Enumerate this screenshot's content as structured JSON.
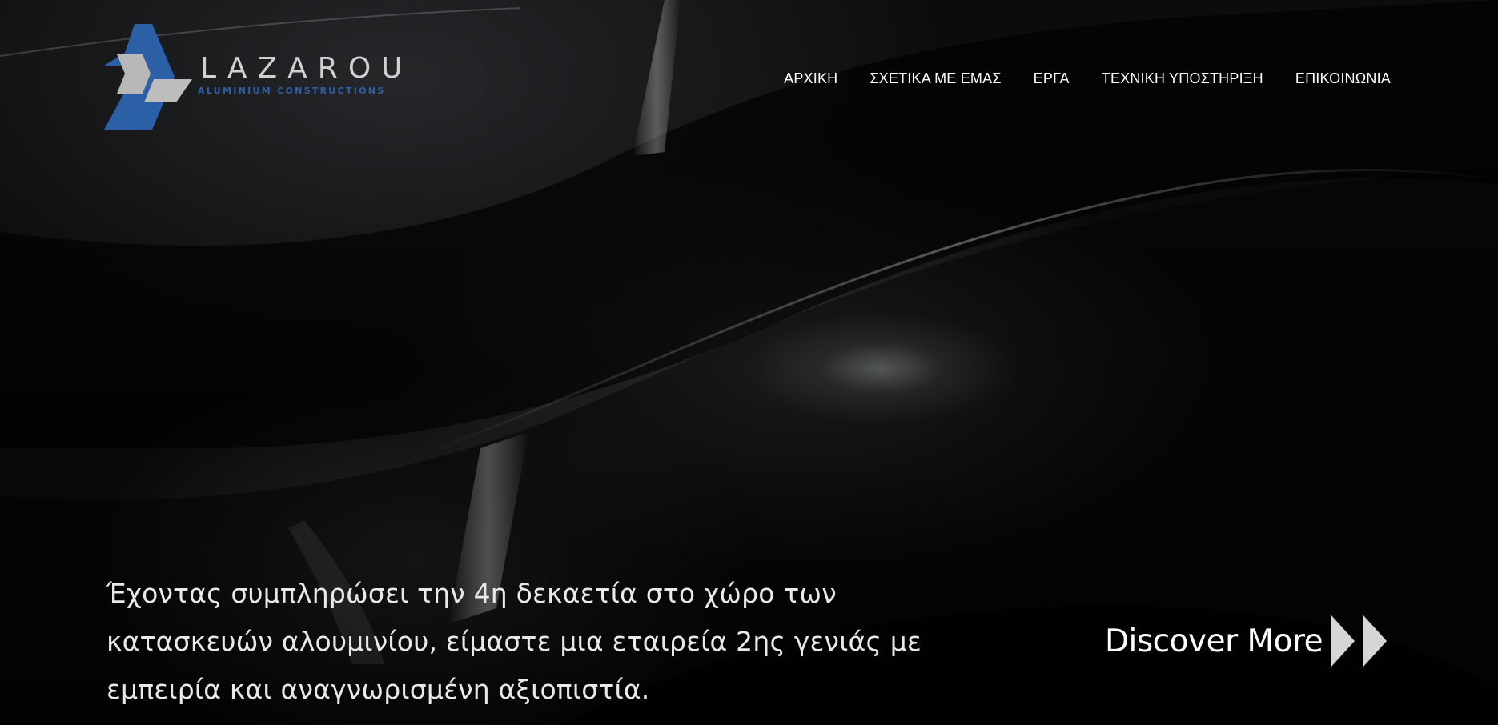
{
  "brand": {
    "name": "LAZAROU",
    "tagline": "ALUMINIUM CONSTRUCTIONS",
    "mark_colors": {
      "blue": "#2b5fa6",
      "gray": "#b9b9b9"
    }
  },
  "nav": {
    "items": [
      {
        "label": "ΑΡΧΙΚΗ"
      },
      {
        "label": "ΣΧΕΤΙΚΑ ΜΕ ΕΜΑΣ"
      },
      {
        "label": "ΕΡΓΑ"
      },
      {
        "label": "ΤΕΧΝΙΚΗ ΥΠΟΣΤΗΡΙΞΗ"
      },
      {
        "label": "ΕΠΙΚΟΙΝΩΝΙΑ"
      }
    ]
  },
  "hero": {
    "intro": "Έχοντας συμπληρώσει την 4η δεκαετία στο χώρο των κατασκευών αλουμινίου, είμαστε μια εταιρεία 2ης γενιάς με εμπειρία και αναγνωρισμένη αξιοπιστία.",
    "cta_label": "Discover More",
    "cta_icon": "double-chevron-right-icon"
  },
  "colors": {
    "background": "#050505",
    "text": "#ffffff",
    "accent": "#2f5fa8"
  }
}
